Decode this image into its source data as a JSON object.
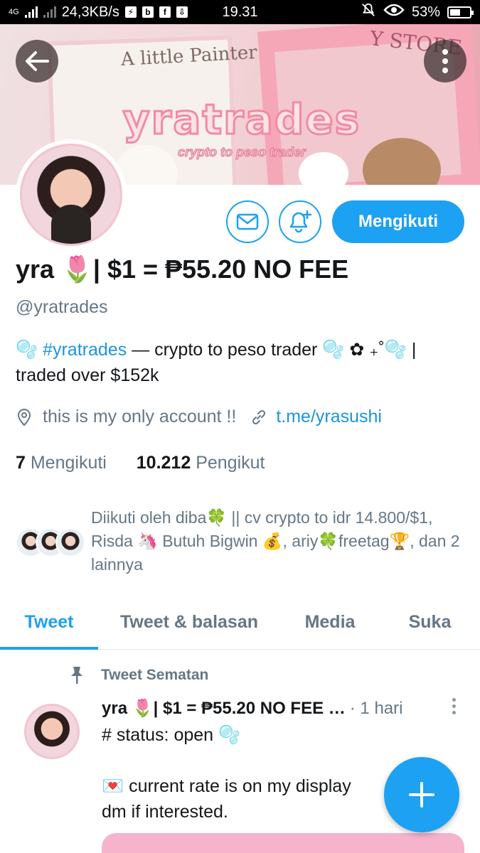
{
  "status_bar": {
    "network_label": "4G",
    "speed": "24,3KB/s",
    "time": "19.31",
    "battery": "53%",
    "battery_level": 0.53
  },
  "banner": {
    "title": "yratrades",
    "subtitle": "crypto to peso trader",
    "box_text": "A little Painter",
    "store_text": "Y STORE"
  },
  "actions": {
    "follow_label": "Mengikuti"
  },
  "profile": {
    "name": "yra 🌷| $1 = ₱55.20 NO FEE",
    "handle": "@yratrades",
    "bio_prefix": "🫧 ",
    "bio_hashtag": "#yratrades",
    "bio_rest": " — crypto to peso trader 🫧  ✿  ₊˚🫧 | traded over $152k",
    "location": "this is my only account !!",
    "website": "t.me/yrasushi",
    "following_count": "7",
    "following_label": "Mengikuti",
    "followers_count": "10.212",
    "followers_label": "Pengikut",
    "followed_by": "Diikuti oleh diba🍀 || cv crypto to idr 14.800/$1, Risda 🦄 Butuh Bigwin 💰, ariy🍀freetag🏆, dan 2 lainnya"
  },
  "tabs": [
    {
      "label": "Tweet",
      "active": true
    },
    {
      "label": "Tweet & balasan",
      "active": false
    },
    {
      "label": "Media",
      "active": false
    },
    {
      "label": "Suka",
      "active": false
    }
  ],
  "pinned_tweet": {
    "pinned_label": "Tweet Sematan",
    "author": "yra 🌷| $1 = ₱55.20 NO FEE …",
    "time": "· 1 hari",
    "body": "# status: open 🫧\n\n💌 current rate is on my display\ndm if interested."
  },
  "colors": {
    "accent": "#1da1f2",
    "secondary_text": "#657786",
    "link": "#1b95e0"
  }
}
